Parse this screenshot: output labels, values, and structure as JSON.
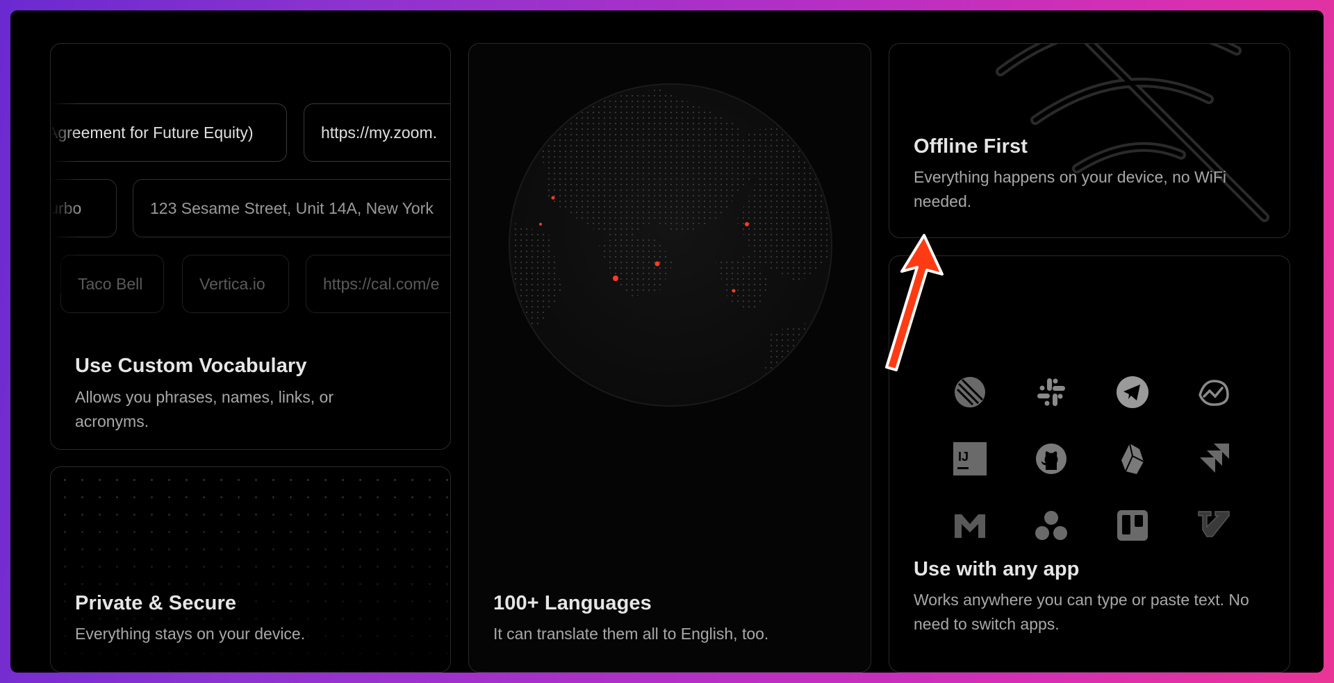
{
  "vocabulary": {
    "title": "Use Custom Vocabulary",
    "description": "Allows you phrases, names, links, or acronyms.",
    "chips_row1": [
      "Agreement for Future Equity)",
      "https://my.zoom."
    ],
    "chips_row2": [
      "Turbo",
      "123 Sesame Street, Unit 14A, New York"
    ],
    "chips_row3": [
      "Taco Bell",
      "Vertica.io",
      "https://cal.com/e"
    ]
  },
  "private": {
    "title": "Private & Secure",
    "description": "Everything stays on your device."
  },
  "languages": {
    "title": "100+ Languages",
    "description": "It can translate them all to English, too."
  },
  "offline": {
    "title": "Offline First",
    "description": "Everything happens on your device, no WiFi needed.",
    "background_icon": "wifi-off-icon"
  },
  "apps": {
    "title": "Use with any app",
    "description": "Works anywhere you can type or paste text. No need to switch apps.",
    "icons": [
      "linear-icon",
      "slack-icon",
      "telegram-icon",
      "basecamp-icon",
      "intellij-icon",
      "github-icon",
      "obsidian-icon",
      "jira-icon",
      "gmail-icon",
      "asana-icon",
      "trello-icon",
      "vim-icon"
    ]
  },
  "colors": {
    "accent_dot": "#ff3b1f",
    "arrow": "#ff3b14"
  }
}
